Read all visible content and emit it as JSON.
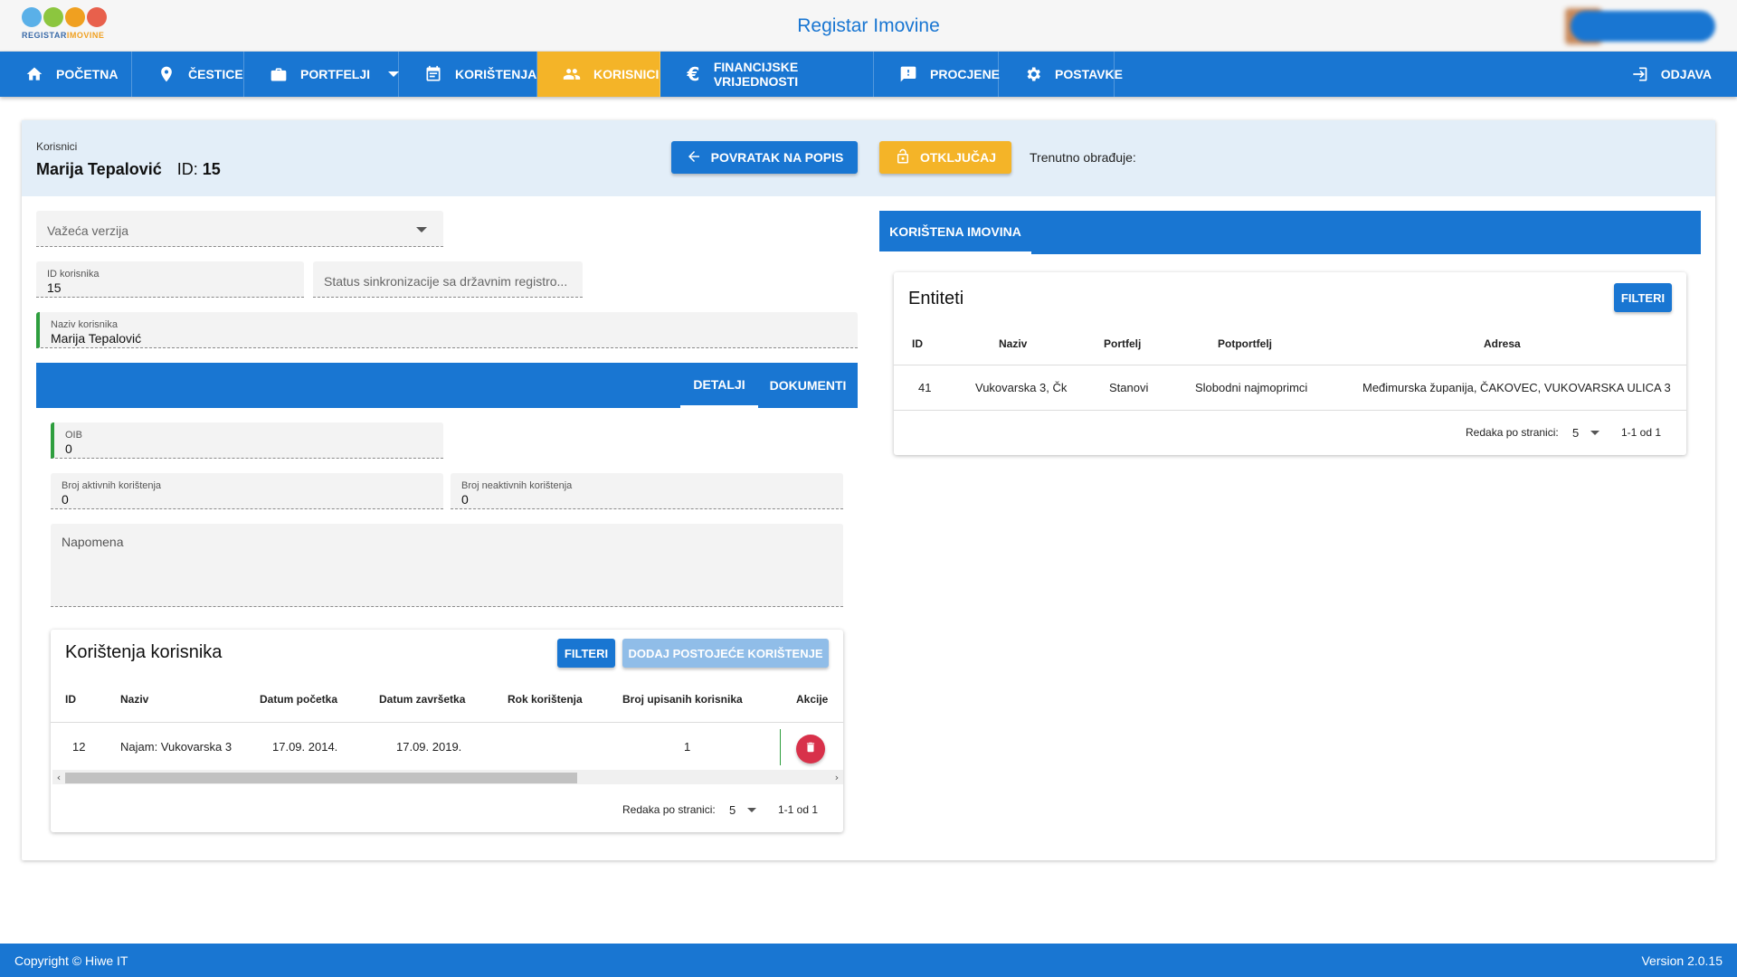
{
  "app": {
    "title": "Registar Imovine",
    "logo_text_a": "REGISTAR",
    "logo_text_b": "IMOVINE"
  },
  "nav": {
    "items": [
      {
        "label": "POČETNA",
        "icon": "home-icon"
      },
      {
        "label": "ČESTICE",
        "icon": "location-pin-icon"
      },
      {
        "label": "PORTFELJI",
        "icon": "briefcase-icon"
      },
      {
        "label": "KORIŠTENJA",
        "icon": "calendar-icon"
      },
      {
        "label": "KORISNICI",
        "icon": "users-icon"
      },
      {
        "label": "FINANCIJSKE VRIJEDNOSTI",
        "icon": "euro-icon"
      },
      {
        "label": "PROCJENE",
        "icon": "feedback-icon"
      },
      {
        "label": "POSTAVKE",
        "icon": "gear-icon"
      }
    ],
    "logout": "ODJAVA",
    "active_color": "#f4b428",
    "bar_color": "#1976d2"
  },
  "header": {
    "breadcrumb": "Korisnici",
    "name": "Marija Tepalović",
    "id_label": "ID:",
    "id_value": "15",
    "back_button": "POVRATAK NA POPIS",
    "unlock_button": "OTKLJUČAJ",
    "editing_label": "Trenutno obrađuje:"
  },
  "form": {
    "version_placeholder": "Važeća verzija",
    "user_id_label": "ID korisnika",
    "user_id_value": "15",
    "sync_status_placeholder": "Status sinkronizacije sa državnim registro...",
    "user_name_label": "Naziv korisnika",
    "user_name_value": "Marija Tepalović",
    "tabs": [
      "DETALJI",
      "DOKUMENTI"
    ],
    "oib_label": "OIB",
    "oib_value": "0",
    "active_uses_label": "Broj aktivnih korištenja",
    "active_uses_value": "0",
    "inactive_uses_label": "Broj neaktivnih korištenja",
    "inactive_uses_value": "0",
    "note_placeholder": "Napomena"
  },
  "usages": {
    "title": "Korištenja korisnika",
    "filter_button": "FILTERI",
    "add_button": "DODAJ POSTOJEĆE KORIŠTENJE",
    "columns": [
      "ID",
      "Naziv",
      "Datum početka",
      "Datum završetka",
      "Rok korištenja",
      "Broj upisanih korisnika",
      "Akcije"
    ],
    "rows": [
      {
        "id": "12",
        "name": "Najam: Vukovarska 3",
        "start": "17.09. 2014.",
        "end": "17.09. 2019.",
        "term": "",
        "users": "1"
      }
    ],
    "rows_per_page_label": "Redaka po stranici:",
    "rows_per_page": "5",
    "range": "1-1 od 1"
  },
  "used_assets": {
    "tab": "KORIŠTENA IMOVINA",
    "title": "Entiteti",
    "filter_button": "FILTERI",
    "columns": [
      "ID",
      "Naziv",
      "Portfelj",
      "Potportfelj",
      "Adresa"
    ],
    "rows": [
      {
        "id": "41",
        "name": "Vukovarska 3, Čk",
        "portfolio": "Stanovi",
        "subportfolio": "Slobodni najmoprimci",
        "address": "Međimurska županija, ČAKOVEC, VUKOVARSKA ULICA 3"
      }
    ],
    "rows_per_page_label": "Redaka po stranici:",
    "rows_per_page": "5",
    "range": "1-1 od 1"
  },
  "footer": {
    "copyright": "Copyright © Hiwe IT",
    "version": "Version 2.0.15"
  }
}
